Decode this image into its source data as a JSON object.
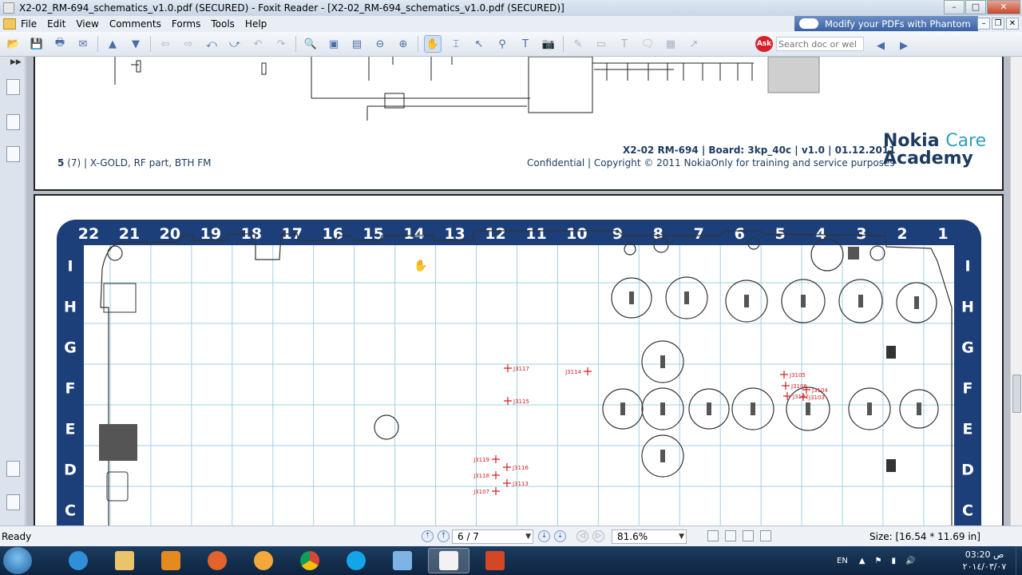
{
  "window": {
    "title": "X2-02_RM-694_schematics_v1.0.pdf (SECURED) - Foxit Reader - [X2-02_RM-694_schematics_v1.0.pdf (SECURED)]",
    "controls": {
      "minimize": "–",
      "maximize": "□",
      "close": "✕"
    }
  },
  "menu": {
    "items": [
      "File",
      "Edit",
      "View",
      "Comments",
      "Forms",
      "Tools",
      "Help"
    ],
    "ad": "Modify your PDFs with Phantom",
    "doc_controls": {
      "minimize": "–",
      "restore": "❐",
      "close": "✕"
    }
  },
  "toolbar": {
    "search_placeholder": "Search doc or wel",
    "ask_label": "Ask"
  },
  "page1": {
    "footer_page": "5",
    "footer_page_total": "(7)",
    "footer_title": "X-GOLD, RF part, BTH FM",
    "footer_model_line": "X2-02 RM-694 | Board: 3kp_40c | v1.0 | 01.12.2011",
    "footer_copyright_line": "Confidential | Copyright © 2011 NokiaOnly for training and service purposes",
    "logo_line1": "Nokia",
    "logo_care": "Care",
    "logo_line2": "Academy"
  },
  "page2": {
    "grid_columns": [
      "22",
      "21",
      "20",
      "19",
      "18",
      "17",
      "16",
      "15",
      "14",
      "13",
      "12",
      "11",
      "10",
      "9",
      "8",
      "7",
      "6",
      "5",
      "4",
      "3",
      "2",
      "1"
    ],
    "grid_rows": [
      "I",
      "H",
      "G",
      "F",
      "E",
      "D",
      "C"
    ],
    "test_points": [
      "J3117",
      "J3114",
      "J3115",
      "J3105",
      "J3106",
      "J3102",
      "J3104",
      "J3103",
      "J3119",
      "J3116",
      "J3118",
      "J3113",
      "J3107"
    ],
    "colors": {
      "frame": "#1c3f7a",
      "grid": "#9fd0e6",
      "testpoint": "#d02020"
    }
  },
  "statusbar": {
    "ready": "Ready",
    "page_field": "6 / 7",
    "zoom_field": "81.6%",
    "size_label": "Size: [16.54 * 11.69 in]"
  },
  "taskbar": {
    "lang": "EN",
    "clock_time": "ص 03:20",
    "clock_date": "٢٠١٤/٠٣/٠٧"
  }
}
